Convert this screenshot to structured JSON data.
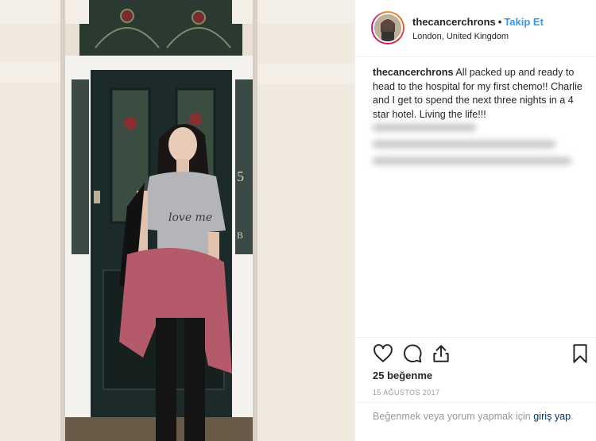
{
  "post": {
    "username": "thecancerchrons",
    "separator": "•",
    "follow_label": "Takip Et",
    "location": "London, United Kingdom",
    "caption_text": "All packed up and ready to head to the hospital for my first chemo!! Charlie and I get to spend the next three nights in a 4 star hotel. Living the life!!!",
    "likes": "25 beğenme",
    "date": "15 AĞUSTOS 2017",
    "login_prompt": "Beğenmek veya yorum yapmak için",
    "login_link": "giriş yap",
    "login_suffix": "."
  },
  "photo": {
    "door_number": "5",
    "door_letter": "B",
    "shirt_text": "love me"
  },
  "icons": {
    "like": "heart-icon",
    "comment": "comment-icon",
    "share": "share-icon",
    "save": "bookmark-icon"
  },
  "colors": {
    "follow": "#3897f0",
    "link": "#003569",
    "muted": "#999999",
    "text": "#262626"
  }
}
